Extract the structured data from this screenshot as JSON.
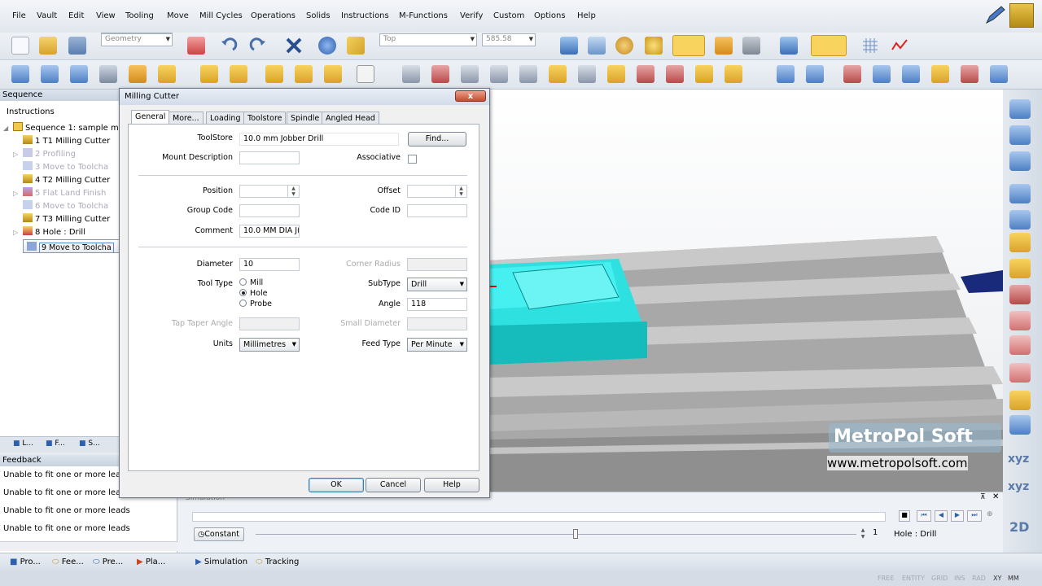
{
  "menu": [
    "File",
    "Vault",
    "Edit",
    "View",
    "Tooling",
    "Move",
    "Mill Cycles",
    "Operations",
    "Solids",
    "Instructions",
    "M-Functions",
    "Verify",
    "Custom",
    "Options",
    "Help"
  ],
  "toolbar": {
    "geometry_combo": "Geometry",
    "view_combo": "Top",
    "z_value": "585.58"
  },
  "sequence_panel": {
    "title": "Sequence",
    "subtitle": "Instructions",
    "items": [
      {
        "label": "Sequence 1: sample m",
        "state": "normal"
      },
      {
        "label": "1 T1 Milling Cutter",
        "state": "normal"
      },
      {
        "label": "2 Profiling",
        "state": "dim"
      },
      {
        "label": "3 Move to Toolcha",
        "state": "dim"
      },
      {
        "label": "4 T2 Milling Cutter",
        "state": "normal"
      },
      {
        "label": "5 Flat Land Finish",
        "state": "dim"
      },
      {
        "label": "6 Move to Toolcha",
        "state": "dim"
      },
      {
        "label": "7 T3 Milling Cutter",
        "state": "normal"
      },
      {
        "label": "8 Hole : Drill",
        "state": "normal"
      },
      {
        "label": "9 Move to Toolcha",
        "state": "selected"
      }
    ],
    "tabs": [
      "L...",
      "F...",
      "S..."
    ]
  },
  "feedback": {
    "title": "Feedback",
    "lines": [
      "Unable to fit one or more leads",
      "Unable to fit one or more leads",
      "Unable to fit one or more leads",
      "Unable to fit one or more leads"
    ]
  },
  "bottom_tabs": [
    "Pro...",
    "Fee...",
    "Pre...",
    "Pla...",
    "Simulation",
    "Tracking"
  ],
  "simulation": {
    "title": "Simulation",
    "constant_label": "Constant",
    "step_value": "1",
    "current_op": "Hole : Drill"
  },
  "status_modes": [
    "FREE",
    "ENTITY",
    "GRID",
    "INS",
    "RAD",
    "XY",
    "MM"
  ],
  "dialog": {
    "title": "Milling Cutter",
    "close_label": "x",
    "tabs": [
      "General",
      "More...",
      "Loading",
      "Toolstore",
      "Spindle",
      "Angled Head"
    ],
    "active_tab": "General",
    "toolstore_label": "ToolStore",
    "toolstore_value": "10.0 mm Jobber Drill",
    "find_label": "Find...",
    "mount_desc_label": "Mount Description",
    "associative_label": "Associative",
    "position_label": "Position",
    "offset_label": "Offset",
    "group_code_label": "Group Code",
    "code_id_label": "Code ID",
    "comment_label": "Comment",
    "comment_value": "10.0 MM DIA J(",
    "diameter_label": "Diameter",
    "diameter_value": "10",
    "corner_radius_label": "Corner Radius",
    "tool_type_label": "Tool Type",
    "tool_type_options": [
      "Mill",
      "Hole",
      "Probe"
    ],
    "tool_type_selected": "Hole",
    "subtype_label": "SubType",
    "subtype_value": "Drill",
    "angle_label": "Angle",
    "angle_value": "118",
    "tap_taper_label": "Tap Taper Angle",
    "small_diameter_label": "Small Diameter",
    "units_label": "Units",
    "units_value": "Millimetres",
    "feed_type_label": "Feed Type",
    "feed_type_value": "Per Minute",
    "ok_label": "OK",
    "cancel_label": "Cancel",
    "help_label": "Help"
  },
  "watermark": {
    "logo_text": "MetroPol Soft",
    "url": "www.metropolsoft.com"
  },
  "right_panel": {
    "xyz1": "xyz",
    "xyz2": "xyz",
    "view2d": "2D"
  },
  "colors": {
    "part": "#2fe0e0",
    "table": "#9a9a9a",
    "selection": "#5b86c7"
  }
}
